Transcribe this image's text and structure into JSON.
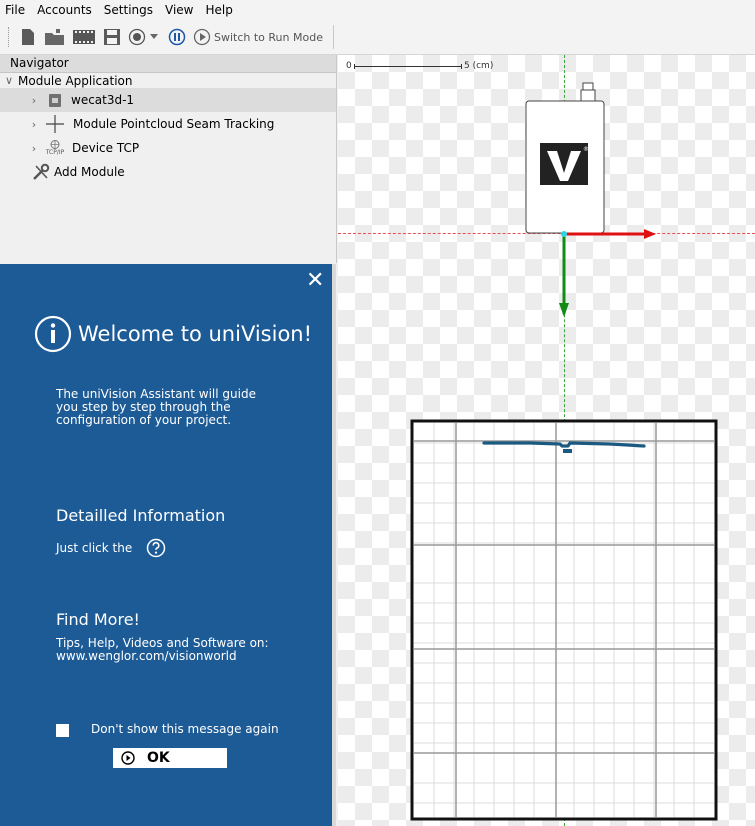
{
  "menu": [
    "File",
    "Accounts",
    "Settings",
    "View",
    "Help"
  ],
  "toolbar": {
    "run_mode_label": "Switch to Run Mode"
  },
  "navigator": {
    "title": "Navigator",
    "root": "Module Application",
    "items": [
      {
        "label": "wecat3d-1",
        "icon": "sensor-icon"
      },
      {
        "label": "Module Pointcloud Seam Tracking",
        "icon": "crosshair-icon"
      },
      {
        "label": "Device TCP",
        "icon": "tcp-ip-icon",
        "icon_text": "TCP/IP"
      },
      {
        "label": "Add Module",
        "icon": "tools-icon"
      }
    ]
  },
  "welcome": {
    "title": "Welcome to uniVision!",
    "intro": "The uniVision Assistant will guide\nyou step by step through the\nconfiguration of your project.",
    "detail_heading": "Detailled Information",
    "detail_text": "Just click the",
    "find_heading": "Find More!",
    "find_text": "Tips, Help, Videos and Software on:\nwww.wenglor.com/visionworld",
    "dont_show": "Don't show this message again",
    "ok": "OK"
  },
  "canvas": {
    "scale_start": "0",
    "scale_end": "5 (cm)",
    "device_logo_text": "W"
  },
  "colors": {
    "panel_blue": "#1d5b97",
    "axis_x": "#e01010",
    "axis_y": "#138a13",
    "profile": "#1a5a80"
  }
}
